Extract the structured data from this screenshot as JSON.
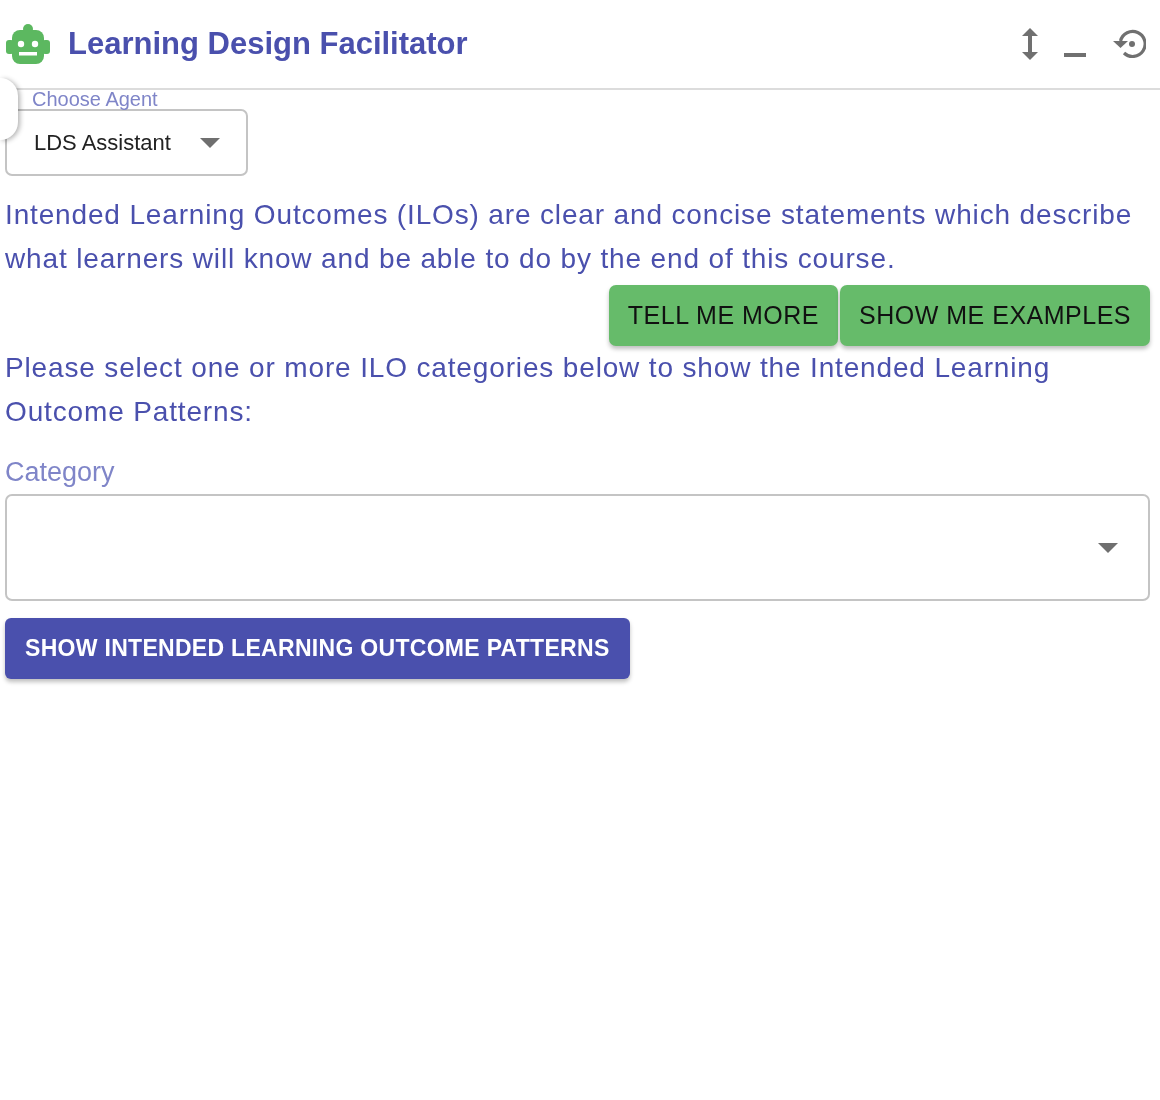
{
  "header": {
    "title": "Learning Design Facilitator"
  },
  "agent_select": {
    "label": "Choose Agent",
    "value": "LDS Assistant"
  },
  "intro": "Intended Learning Outcomes (ILOs) are clear and concise statements which describe what learners will know and be able to do by the end of this course.",
  "info_buttons": [
    "TELL ME MORE",
    "SHOW ME EXAMPLES"
  ],
  "instruction": "Please select one or more ILO categories below to show the Intended Learning Outcome Patterns:",
  "category_select": {
    "label": "Category"
  },
  "submit_button": "SHOW INTENDED LEARNING OUTCOME PATTERNS"
}
